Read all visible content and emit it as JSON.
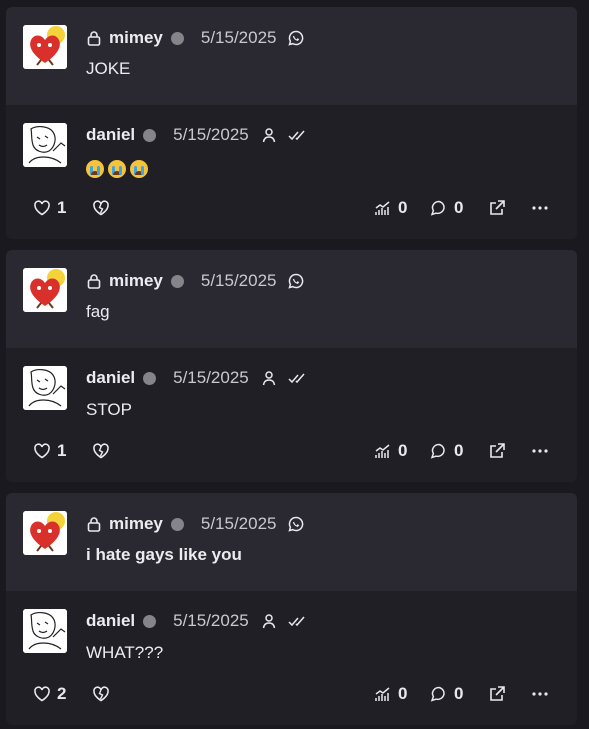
{
  "threads": [
    {
      "quoted": {
        "name": "mimey",
        "date": "5/15/2025",
        "text": "JOKE"
      },
      "reply": {
        "name": "daniel",
        "date": "5/15/2025",
        "text": "",
        "emoji_count": 3,
        "likes": "1",
        "views": "0",
        "comments": "0"
      }
    },
    {
      "quoted": {
        "name": "mimey",
        "date": "5/15/2025",
        "text": "fag"
      },
      "reply": {
        "name": "daniel",
        "date": "5/15/2025",
        "text": "STOP",
        "likes": "1",
        "views": "0",
        "comments": "0"
      }
    },
    {
      "quoted": {
        "name": "mimey",
        "date": "5/15/2025",
        "text": "i hate gays like you"
      },
      "reply": {
        "name": "daniel",
        "date": "5/15/2025",
        "text": "WHAT???",
        "likes": "2",
        "views": "0",
        "comments": "0"
      }
    }
  ],
  "icons": {
    "quoted_header": [
      "lock-icon",
      "presence-dot",
      "whatsapp-icon"
    ],
    "reply_header": [
      "presence-dot",
      "person-icon",
      "double-check-icon"
    ],
    "actions": [
      "heart-icon",
      "heart-crack-icon",
      "views-chart-icon",
      "comment-icon",
      "share-external-icon",
      "more-icon"
    ]
  },
  "colors": {
    "background": "#1a1920",
    "quoted_bg": "#2a2831",
    "reply_bg": "#201f26",
    "presence": "#85848a"
  }
}
